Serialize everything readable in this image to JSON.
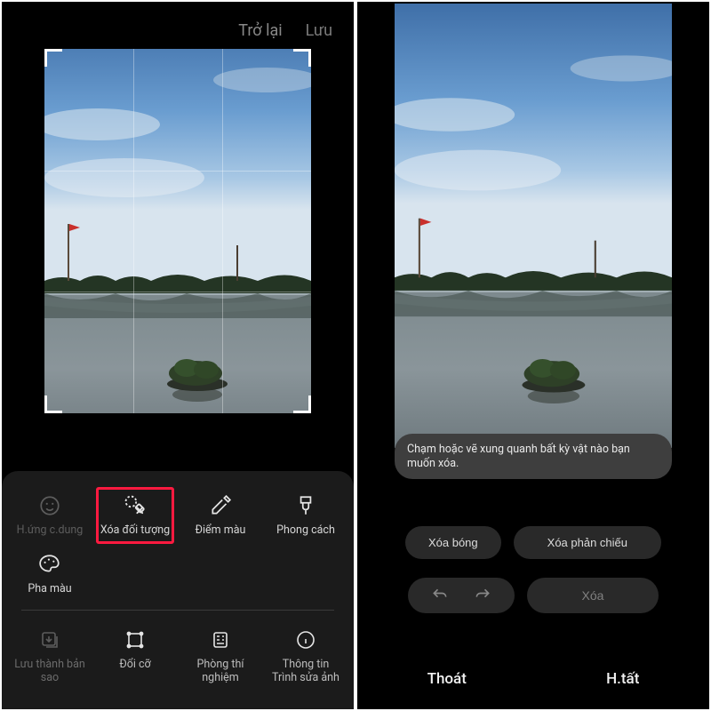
{
  "left": {
    "header": {
      "back": "Trở lại",
      "save": "Lưu"
    },
    "tools": {
      "portrait": "H.ứng c.dung",
      "erase_object": "Xóa đối tượng",
      "color_point": "Điểm màu",
      "style": "Phong cách",
      "color_mix": "Pha màu"
    },
    "bottom": {
      "save_copy": "Lưu thành bản sao",
      "resize": "Đổi cỡ",
      "labs": "Phòng thí nghiệm",
      "info": "Thông tin Trình sửa ảnh"
    }
  },
  "right": {
    "hint": "Chạm hoặc vẽ xung quanh bất kỳ vật nào bạn muốn xóa.",
    "erase_shadow": "Xóa bóng",
    "erase_reflection": "Xóa phản chiếu",
    "delete": "Xóa",
    "exit": "Thoát",
    "done": "H.tất"
  }
}
